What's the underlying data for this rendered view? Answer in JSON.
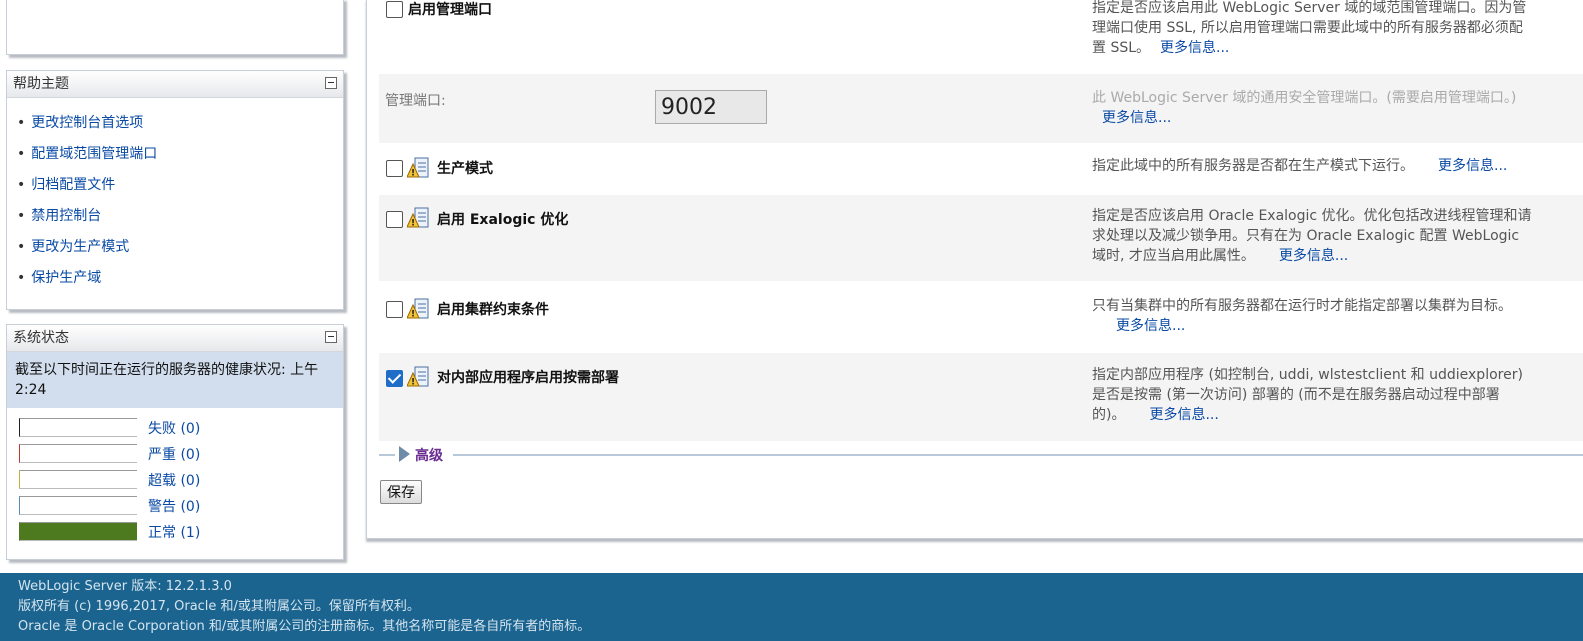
{
  "help": {
    "title": "帮助主题",
    "items": [
      "更改控制台首选项",
      "配置域范围管理端口",
      "归档配置文件",
      "禁用控制台",
      "更改为生产模式",
      "保护生产域"
    ]
  },
  "status": {
    "title": "系统状态",
    "description": "截至以下时间正在运行的服务器的健康状况: 上午2:24",
    "health": [
      {
        "label": "失败 (0)",
        "fraction": 0,
        "color": "#222222"
      },
      {
        "label": "严重 (0)",
        "fraction": 0,
        "color": "#c0392b"
      },
      {
        "label": "超载 (0)",
        "fraction": 0,
        "color": "#c9b038"
      },
      {
        "label": "警告 (0)",
        "fraction": 0,
        "color": "#5a8cb5"
      },
      {
        "label": "正常 (1)",
        "fraction": 1,
        "color": "#4d7a1f"
      }
    ]
  },
  "settings": {
    "admin_port_enable": {
      "label": "启用管理端口",
      "checked": false,
      "description": "指定是否应该启用此 WebLogic Server 域的域范围管理端口。因为管理端口使用 SSL, 所以启用管理端口需要此域中的所有服务器都必须配置 SSL。",
      "more": "更多信息..."
    },
    "admin_port": {
      "label": "管理端口:",
      "value": "9002",
      "description": "此 WebLogic Server 域的通用安全管理端口。(需要启用管理端口。)",
      "more": "更多信息..."
    },
    "production_mode": {
      "label": "生产模式",
      "checked": false,
      "description": "指定此域中的所有服务器是否都在生产模式下运行。",
      "more": "更多信息..."
    },
    "exalogic": {
      "label": "启用 Exalogic 优化",
      "checked": false,
      "description": "指定是否应该启用 Oracle Exalogic 优化。优化包括改进线程管理和请求处理以及减少锁争用。只有在为 Oracle Exalogic 配置 WebLogic 域时, 才应当启用此属性。",
      "more": "更多信息..."
    },
    "cluster_constraints": {
      "label": "启用集群约束条件",
      "checked": false,
      "description": "只有当集群中的所有服务器都在运行时才能指定部署以集群为目标。",
      "more": "更多信息..."
    },
    "on_demand_deploy": {
      "label": "对内部应用程序启用按需部署",
      "checked": true,
      "description": "指定内部应用程序 (如控制台, uddi, wlstestclient 和 uddiexplorer) 是否是按需 (第一次访问) 部署的 (而不是在服务器启动过程中部署的)。",
      "more": "更多信息..."
    }
  },
  "advanced_label": "高级",
  "save_label": "保存",
  "footer": {
    "version": "WebLogic Server 版本: 12.2.1.3.0",
    "copyright": "版权所有 (c) 1996,2017, Oracle 和/或其附属公司。保留所有权利。",
    "trademark": "Oracle 是 Oracle Corporation 和/或其附属公司的注册商标。其他名称可能是各自所有者的商标。"
  }
}
